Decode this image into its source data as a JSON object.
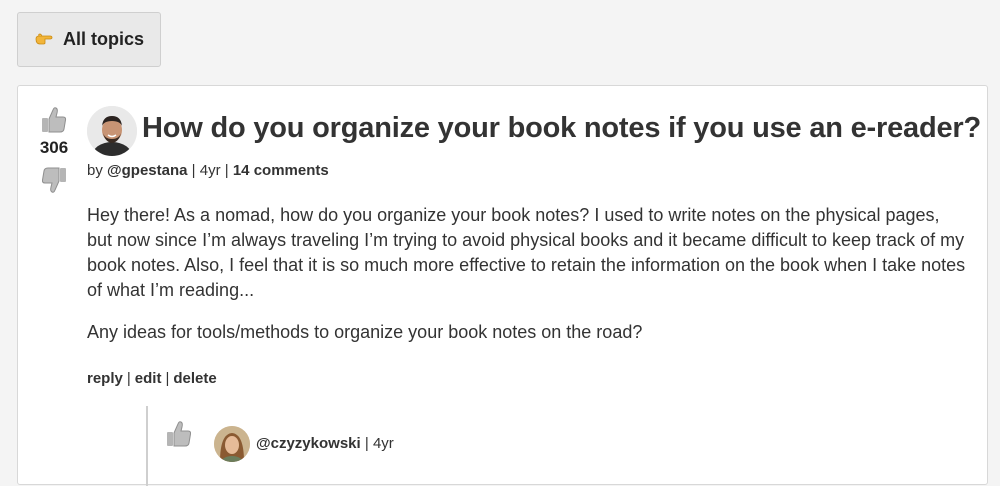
{
  "nav": {
    "all_topics_label": "All topics",
    "all_topics_icon": "pointing-hand-icon"
  },
  "post": {
    "score": "306",
    "title": "How do you organize your book notes if you use an e-reader?",
    "meta": {
      "by": "by",
      "author": "@gpestana",
      "sep1": "|",
      "age": "4yr",
      "sep2": "|",
      "comments": "14 comments"
    },
    "body": [
      "Hey there! As a nomad, how do you organize your book notes? I used to write notes on the physical pages, but now since I’m always traveling I’m trying to avoid physical books and it became difficult to keep track of my book notes. Also, I feel that it is so much more effective to retain the information on the book when I take notes of what I’m reading...",
      "Any ideas for tools/methods to organize your book notes on the road?"
    ],
    "actions": {
      "reply": "reply",
      "edit": "edit",
      "delete": "delete",
      "sep": "|"
    }
  },
  "reply": {
    "author": "@czyzykowski",
    "sep": "|",
    "age": "4yr"
  },
  "colors": {
    "background": "#f4f4f4",
    "card": "#ffffff",
    "text": "#333333",
    "thumb": "#9a9a9a"
  }
}
